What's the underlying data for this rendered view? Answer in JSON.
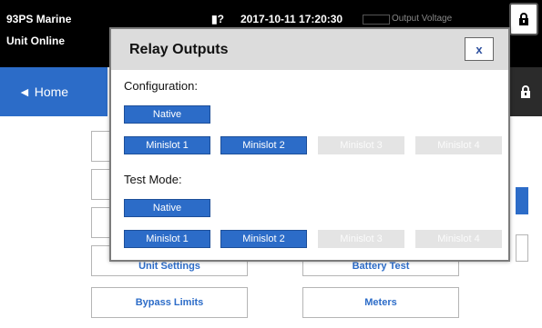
{
  "header": {
    "unit_name": "93PS Marine",
    "unit_status": "Unit Online",
    "status_icons": "▮?",
    "datetime": "2017-10-11 17:20:30",
    "output_label": "Output Voltage",
    "lock_glyph": "🔒"
  },
  "nav": {
    "home_label": "◄  Home"
  },
  "menu": {
    "partial_left_label": "Unit Settings",
    "partial_right_label": "Battery Test",
    "bypass_limits_label": "Bypass Limits",
    "meters_label": "Meters"
  },
  "dialog": {
    "title": "Relay Outputs",
    "close_label": "x",
    "configuration": {
      "label": "Configuration:",
      "native": {
        "label": "Native",
        "active": true
      },
      "slots": [
        {
          "label": "Minislot 1",
          "active": true
        },
        {
          "label": "Minislot 2",
          "active": true
        },
        {
          "label": "Minislot 3",
          "active": false
        },
        {
          "label": "Minislot 4",
          "active": false
        }
      ]
    },
    "test_mode": {
      "label": "Test Mode:",
      "native": {
        "label": "Native",
        "active": true
      },
      "slots": [
        {
          "label": "Minislot 1",
          "active": true
        },
        {
          "label": "Minislot 2",
          "active": true
        },
        {
          "label": "Minislot 3",
          "active": false
        },
        {
          "label": "Minislot 4",
          "active": false
        }
      ]
    }
  },
  "colors": {
    "accent": "#2c6cc8",
    "disabled": "#e4e4e4"
  }
}
